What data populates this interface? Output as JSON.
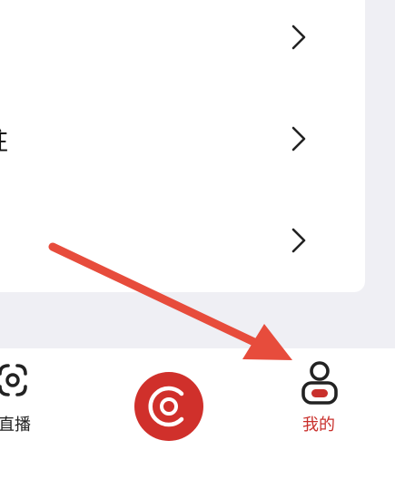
{
  "menu": {
    "items": [
      {
        "label": ""
      },
      {
        "label": "驻"
      },
      {
        "label": ""
      }
    ]
  },
  "tabbar": {
    "live_label": "直播",
    "mine_label": "我的"
  },
  "colors": {
    "accent": "#d0302b",
    "arrow": "#e74c3c",
    "mine_active": "#c9302c"
  }
}
